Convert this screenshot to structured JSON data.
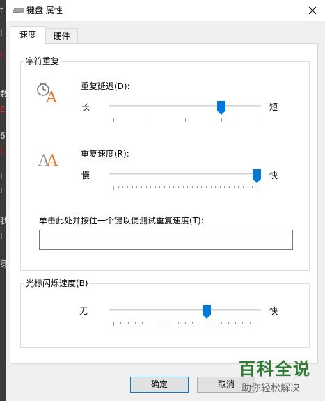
{
  "window": {
    "title": "键盘 属性",
    "icon": "keyboard-icon"
  },
  "left_fragments": [
    {
      "text": "t",
      "color": "#dddddd"
    },
    {
      "text": "I",
      "color": "#dddddd"
    },
    {
      "text": "I",
      "color": "#dd3333"
    },
    {
      "text": "数",
      "color": "#dddddd"
    },
    {
      "text": "E",
      "color": "#dd3333"
    },
    {
      "text": "6",
      "color": "#dddddd"
    },
    {
      "text": "I",
      "color": "#dd3333"
    },
    {
      "text": "I",
      "color": "#dddddd"
    },
    {
      "text": "I",
      "color": "#dddddd"
    },
    {
      "text": "我",
      "color": "#dddddd"
    },
    {
      "text": "I",
      "color": "#dddddd"
    },
    {
      "text": "穿",
      "color": "#dddddd"
    }
  ],
  "tabs": [
    {
      "label": "速度",
      "active": true
    },
    {
      "label": "硬件",
      "active": false
    }
  ],
  "char_repeat": {
    "group_label": "字符重复",
    "delay": {
      "label": "重复延迟(D):",
      "min_label": "长",
      "max_label": "短",
      "value": 3,
      "min": 0,
      "max": 4,
      "icon": "clock-letter-a-icon"
    },
    "rate": {
      "label": "重复速度(R):",
      "min_label": "慢",
      "max_label": "快",
      "value": 31,
      "min": 0,
      "max": 31,
      "icon": "double-letter-a-icon"
    },
    "test_label": "单击此处并按住一个键以便测试重复速度(T):",
    "test_value": ""
  },
  "cursor_blink": {
    "group_label": "光标闪烁速度(B)",
    "min_label": "无",
    "max_label": "快",
    "value": 13,
    "min": 0,
    "max": 20
  },
  "buttons": {
    "ok": "确定",
    "cancel": "取消"
  },
  "watermark": {
    "line1": "百科全说",
    "line2": "助你轻松解决"
  },
  "colors": {
    "accent": "#0078d7",
    "icon_orange": "#e8782a"
  }
}
